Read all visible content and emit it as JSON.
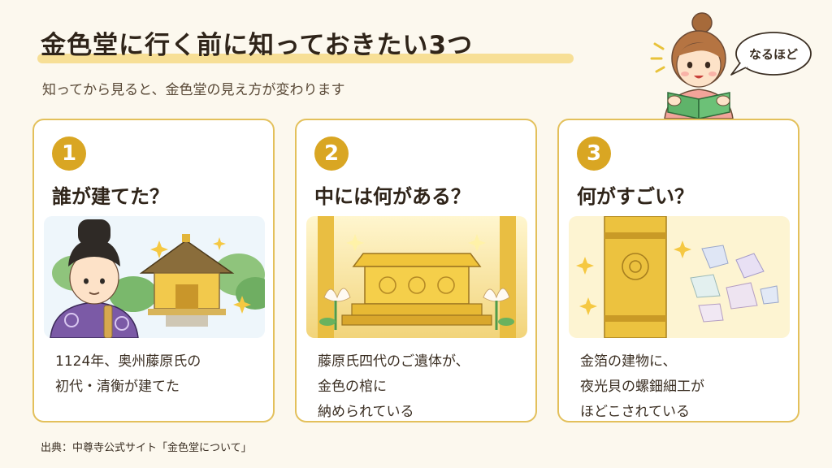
{
  "header": {
    "title": "金色堂に行く前に知っておきたい3つ",
    "subtitle": "知ってから見ると、金色堂の見え方が変わります"
  },
  "bubble": {
    "text": "なるほど"
  },
  "cards": [
    {
      "number": "1",
      "title": "誰が建てた？",
      "lines": [
        "1124年、奥州藤原氏の",
        "初代・清衡が建てた"
      ]
    },
    {
      "number": "2",
      "title": "中には何がある？",
      "lines": [
        "藤原氏四代のご遺体が、",
        "金色の棺に",
        "納められている"
      ]
    },
    {
      "number": "3",
      "title": "何がすごい？",
      "lines": [
        "金箔の建物に、",
        "夜光貝の螺鈿細工が",
        "ほどこされている"
      ]
    }
  ],
  "footer": {
    "source": "出典：中尊寺公式サイト「金色堂について」"
  },
  "colors": {
    "background": "#fcf8ee",
    "accent_gold": "#d9a623",
    "card_border": "#e3c05b",
    "highlight": "#f6dc8c"
  },
  "icons": [
    "girl-reading-illustration",
    "speech-bubble",
    "fujiwara-kiyohira-illustration",
    "konjikido-hall-illustration",
    "golden-coffin-illustration",
    "lotus-icon",
    "golden-pillar-illustration",
    "mother-of-pearl-illustration",
    "sparkle-icon"
  ]
}
